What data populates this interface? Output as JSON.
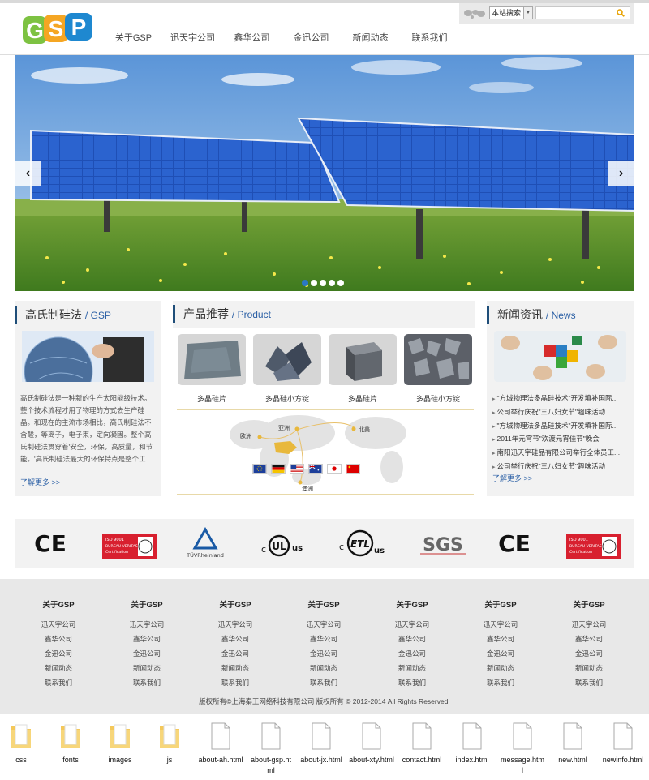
{
  "header": {
    "logo_text": "GSP",
    "nav": [
      "关于GSP",
      "迅天宇公司",
      "鑫华公司",
      "金迅公司",
      "新闻动态",
      "联系我们"
    ],
    "search": {
      "scope_label": "本站搜索",
      "placeholder": "",
      "icons": [
        "world-map-icon",
        "search-icon"
      ]
    }
  },
  "banner": {
    "prev_label": "‹",
    "next_label": "›",
    "slide_count": 5,
    "active_slide": 1
  },
  "left_panel": {
    "title_cn": "高氏制硅法",
    "title_en": "GSP",
    "text": "高氏制硅法是一种新的生产太阳能级技术。整个技术流程才用了物理的方式去生产硅晶。和现在的主流市场相比，高氏制硅法不含酸，等离子，电子束，定向凝固。整个高氏制硅法贯穿着'安全，环保，高质量，和节能。'高氏制硅法最大的环保特点是整个工...",
    "more": "了解更多 >>"
  },
  "products_panel": {
    "title_cn": "产品推荐",
    "title_en": "Product",
    "items": [
      {
        "name": "多晶硅片"
      },
      {
        "name": "多晶硅小方锭"
      },
      {
        "name": "多晶硅片"
      },
      {
        "name": "多晶硅小方锭"
      }
    ],
    "map_labels": {
      "asia": "亚洲",
      "europe": "欧洲",
      "north_america": "北美",
      "australia": "澳洲"
    }
  },
  "news_panel": {
    "title_cn": "新闻资讯",
    "title_en": "News",
    "items": [
      "\"方城物理法多晶硅技术\"开发填补国际...",
      "公司举行庆祝\"三八妇女节\"趣味活动",
      "\"方城物理法多晶硅技术\"开发填补国际...",
      "2011年元宵节\"欢渡元宵佳节\"晚会",
      "南阳迅天宇硅品有限公司举行全体员工...",
      "公司举行庆祝\"三八妇女节\"趣味活动"
    ],
    "more": "了解更多 >>"
  },
  "certifications": [
    "CE",
    "Bureau Veritas",
    "TÜVRheinland",
    "UL",
    "ETL",
    "SGS",
    "CE",
    "Bureau Veritas"
  ],
  "cert_text": {
    "ce": "CE",
    "tuv": "TÜVRheinland",
    "ul_c": "c",
    "ul": "UL",
    "ul_us": "us",
    "etl_c": "c",
    "etl": "ETL",
    "etl_us": "us",
    "sgs": "SGS",
    "bv_top": "ISO 9001",
    "bv_mid": "BUREAU VERITAS",
    "bv_bot": "Certification"
  },
  "footer": {
    "columns": [
      {
        "heading": "关于GSP",
        "links": [
          "迅天宇公司",
          "鑫华公司",
          "金迅公司",
          "新闻动态",
          "联系我们"
        ]
      },
      {
        "heading": "关于GSP",
        "links": [
          "迅天宇公司",
          "鑫华公司",
          "金迅公司",
          "新闻动态",
          "联系我们"
        ]
      },
      {
        "heading": "关于GSP",
        "links": [
          "迅天宇公司",
          "鑫华公司",
          "金迅公司",
          "新闻动态",
          "联系我们"
        ]
      },
      {
        "heading": "关于GSP",
        "links": [
          "迅天宇公司",
          "鑫华公司",
          "金迅公司",
          "新闻动态",
          "联系我们"
        ]
      },
      {
        "heading": "关于GSP",
        "links": [
          "迅天宇公司",
          "鑫华公司",
          "金迅公司",
          "新闻动态",
          "联系我们"
        ]
      },
      {
        "heading": "关于GSP",
        "links": [
          "迅天宇公司",
          "鑫华公司",
          "金迅公司",
          "新闻动态",
          "联系我们"
        ]
      },
      {
        "heading": "关于GSP",
        "links": [
          "迅天宇公司",
          "鑫华公司",
          "金迅公司",
          "新闻动态",
          "联系我们"
        ]
      }
    ],
    "copyright": "版权所有©上海秦王网络科技有限公司 版权所有 © 2012-2014 All Rights Reserved."
  },
  "files": [
    {
      "name": "css",
      "type": "folder"
    },
    {
      "name": "fonts",
      "type": "folder"
    },
    {
      "name": "images",
      "type": "folder"
    },
    {
      "name": "js",
      "type": "folder"
    },
    {
      "name": "about-ah.html",
      "type": "file"
    },
    {
      "name": "about-gsp.html",
      "type": "file"
    },
    {
      "name": "about-jx.html",
      "type": "file"
    },
    {
      "name": "about-xty.html",
      "type": "file"
    },
    {
      "name": "contact.html",
      "type": "file"
    },
    {
      "name": "index.html",
      "type": "file"
    },
    {
      "name": "message.html",
      "type": "file"
    },
    {
      "name": "new.html",
      "type": "file"
    },
    {
      "name": "newinfo.html",
      "type": "file"
    }
  ],
  "colors": {
    "logo_g": "#7dc242",
    "logo_s": "#f5a623",
    "logo_p": "#1e88d0",
    "accent": "#2a5fa5",
    "panel_bg": "#f2f2f2",
    "footer_bg": "#e8e8e8"
  }
}
